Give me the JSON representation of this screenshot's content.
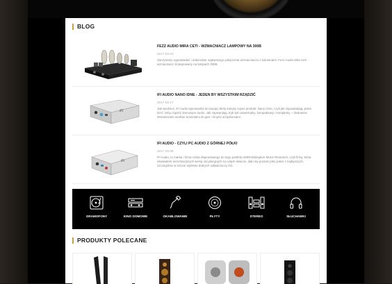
{
  "blog": {
    "title": "BLOG",
    "posts": [
      {
        "title": "FEZZ AUDIO MIRA CETI - WZMACNIACZ LAMPOWY NA 300B",
        "date": "2017-03-23",
        "excerpt": "Zaczynamy wypowiadać i dobieranie najlepszego połączenia wzmacniacza z kolumnami. Fezz Audio Mira Ceti - wzmacniacz zintegrowany na lampach 300B."
      },
      {
        "title": "IFI AUDIO NANO IDNE - JEDEN BY WSZYSTKIM RZĄDZIĆ",
        "date": "2017-03-17",
        "excerpt": "Jak wiedzieć, iFi Audio wprowadza do swojej oferty kolejny super produkt: Nano iOne, czyli jak zapowiadają, jeden DAC żeby rządzić domowym audio. Jak zapewniają, tryb był uniwersalny, kompaktowy i kompletny – dosłownie streamerami medów, konsolami do gier i innymi urządzeniami."
      },
      {
        "title": "IFI AUDIO - CZYLI PC AUDIO Z GÓRNEJ PÓŁKI",
        "date": "2017-03-09",
        "excerpt": "iFi Audio, to marka i firma córka Abpendowego do tego portfela AMR/Abbingdon Music Research, czyli firmy, która ekwiwalent wcześniejszych wersji oscylacyjnych na całym świecie, dało się poznać jako jeden z najlepszych, szczególnie w trzecie wybitnie dobrych odtwarzaczy CD."
      }
    ]
  },
  "categories": [
    {
      "label": "GRAMOFONY",
      "icon": "turntable-icon"
    },
    {
      "label": "KINO DOMOWE",
      "icon": "home-theater-icon"
    },
    {
      "label": "OKABLOWANIE",
      "icon": "cable-icon"
    },
    {
      "label": "PŁYTY",
      "icon": "disc-icon"
    },
    {
      "label": "STEREO",
      "icon": "stereo-icon"
    },
    {
      "label": "SŁUCHAWKI",
      "icon": "headphones-icon"
    }
  ],
  "products": {
    "title": "PRODUKTY POLECANE"
  },
  "colors": {
    "accent": "#c8a13a",
    "band": "#000000"
  }
}
